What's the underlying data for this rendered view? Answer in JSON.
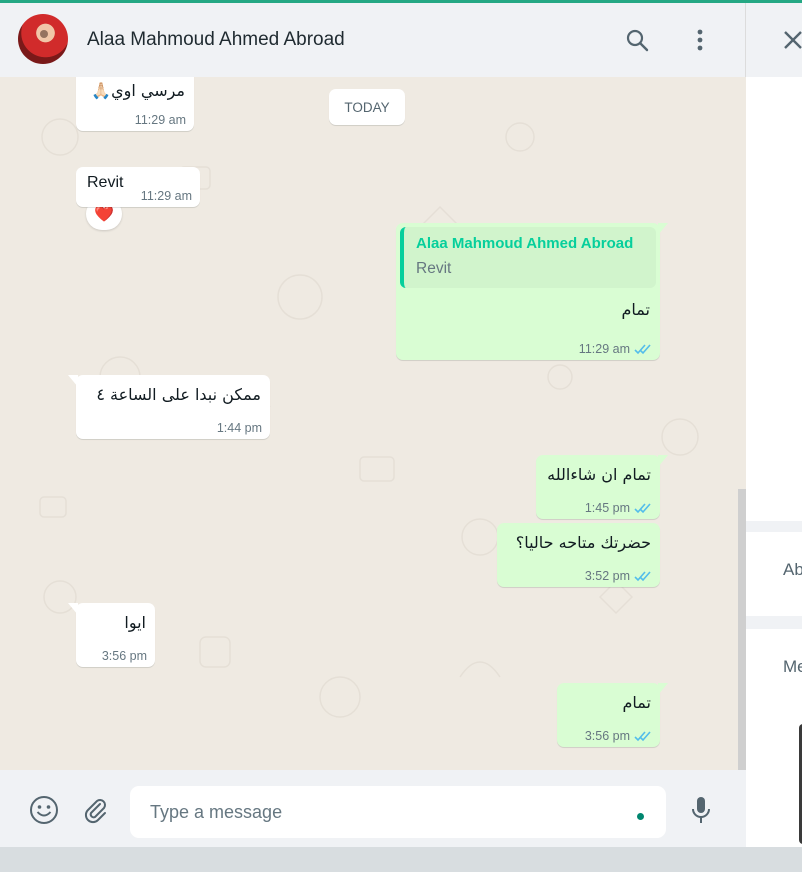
{
  "header": {
    "contact_name": "Alaa Mahmoud Ahmed Abroad",
    "icons": [
      "search-icon",
      "menu-dots-icon"
    ]
  },
  "date_separator": "TODAY",
  "messages": [
    {
      "dir": "in",
      "text": "مرسي اوي🙏🏻",
      "time": "11:29 am",
      "reaction": "❤️"
    },
    {
      "dir": "in",
      "text": "Revit",
      "time": "11:29 am"
    },
    {
      "dir": "out",
      "quote_author": "Alaa Mahmoud Ahmed Abroad",
      "quote_text": "Revit",
      "text": "تمام",
      "time": "11:29 am",
      "status": "read"
    },
    {
      "dir": "in",
      "text": "ممكن نبدا على الساعة ٤",
      "time": "1:44 pm"
    },
    {
      "dir": "out",
      "text": "تمام ان شاءالله",
      "time": "1:45 pm",
      "status": "read"
    },
    {
      "dir": "out",
      "text": "حضرتك متاحه حاليا؟",
      "time": "3:52 pm",
      "status": "read"
    },
    {
      "dir": "in",
      "text": "ايوا",
      "time": "3:56 pm"
    },
    {
      "dir": "out",
      "text": "تمام",
      "time": "3:56 pm",
      "status": "read"
    }
  ],
  "composer": {
    "placeholder": "Type a message"
  },
  "side_panel": {
    "close_icon": "close-icon",
    "about_label": "Ab",
    "media_label": "Me"
  },
  "colors": {
    "accent": "#25a884",
    "outgoing_bubble": "#d9fdd3",
    "incoming_bubble": "#ffffff",
    "chat_bg": "#efeae2",
    "read_ticks": "#53bdeb",
    "quote_accent": "#06cf9c"
  }
}
